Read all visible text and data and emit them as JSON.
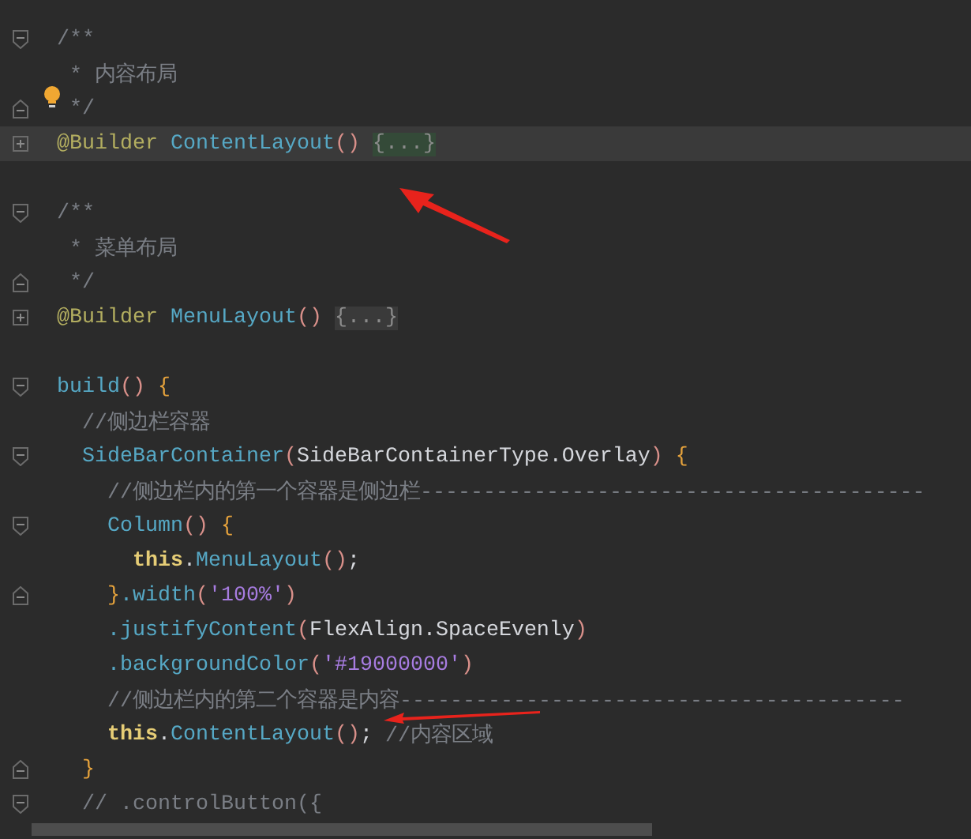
{
  "editor": {
    "lines": [
      {
        "kind": "fold-open",
        "current": false,
        "hint": false,
        "tokens": [
          {
            "kind": "comment",
            "text": "/**"
          }
        ]
      },
      {
        "kind": "plain",
        "current": false,
        "hint": false,
        "tokens": [
          {
            "kind": "comment",
            "text": " * 内容布局"
          }
        ]
      },
      {
        "kind": "fold-end",
        "current": false,
        "hint": true,
        "tokens": [
          {
            "kind": "comment",
            "text": " */"
          }
        ]
      },
      {
        "kind": "collapsed",
        "current": true,
        "hint": false,
        "tokens": [
          {
            "kind": "annotation",
            "text": "@Builder "
          },
          {
            "kind": "function",
            "text": "ContentLayout"
          },
          {
            "kind": "paren",
            "text": "() "
          },
          {
            "kind": "folded",
            "text": "{...}",
            "highlighted": true
          }
        ]
      },
      {
        "kind": "plain",
        "current": false,
        "hint": false
      },
      {
        "kind": "fold-open",
        "current": false,
        "hint": false,
        "tokens": [
          {
            "kind": "comment",
            "text": "/**"
          }
        ]
      },
      {
        "kind": "plain",
        "current": false,
        "hint": false,
        "tokens": [
          {
            "kind": "comment",
            "text": " * 菜单布局"
          }
        ]
      },
      {
        "kind": "fold-end",
        "current": false,
        "hint": false,
        "tokens": [
          {
            "kind": "comment",
            "text": " */"
          }
        ]
      },
      {
        "kind": "collapsed",
        "current": false,
        "hint": false,
        "tokens": [
          {
            "kind": "annotation",
            "text": "@Builder "
          },
          {
            "kind": "function",
            "text": "MenuLayout"
          },
          {
            "kind": "paren",
            "text": "() "
          },
          {
            "kind": "folded",
            "text": "{...}",
            "highlighted": false
          }
        ]
      },
      {
        "kind": "plain",
        "current": false,
        "hint": false
      },
      {
        "kind": "fold-open",
        "current": false,
        "hint": false,
        "tokens": [
          {
            "kind": "function",
            "text": "build"
          },
          {
            "kind": "paren",
            "text": "() "
          },
          {
            "kind": "brace",
            "text": "{"
          }
        ]
      },
      {
        "kind": "plain",
        "current": false,
        "hint": false,
        "tokens": [
          {
            "kind": "comment",
            "text": "  //侧边栏容器"
          }
        ]
      },
      {
        "kind": "fold-open",
        "current": false,
        "hint": false,
        "tokens": [
          {
            "kind": "function",
            "text": "  SideBarContainer"
          },
          {
            "kind": "paren",
            "text": "("
          },
          {
            "kind": "plain",
            "text": "SideBarContainerType.Overlay"
          },
          {
            "kind": "paren",
            "text": ") "
          },
          {
            "kind": "brace",
            "text": "{"
          }
        ]
      },
      {
        "kind": "plain",
        "current": false,
        "hint": false,
        "tokens": [
          {
            "kind": "comment",
            "text": "    //侧边栏内的第一个容器是侧边栏----------------------------------------"
          }
        ]
      },
      {
        "kind": "fold-open",
        "current": false,
        "hint": false,
        "tokens": [
          {
            "kind": "function",
            "text": "    Column"
          },
          {
            "kind": "paren",
            "text": "() "
          },
          {
            "kind": "brace",
            "text": "{"
          }
        ]
      },
      {
        "kind": "plain",
        "current": false,
        "hint": false,
        "tokens": [
          {
            "kind": "keyword",
            "text": "      this"
          },
          {
            "kind": "plain",
            "text": "."
          },
          {
            "kind": "function",
            "text": "MenuLayout"
          },
          {
            "kind": "paren",
            "text": "()"
          },
          {
            "kind": "plain",
            "text": ";"
          }
        ]
      },
      {
        "kind": "fold-end",
        "current": false,
        "hint": false,
        "tokens": [
          {
            "kind": "brace",
            "text": "    }"
          },
          {
            "kind": "function",
            "text": ".width"
          },
          {
            "kind": "paren",
            "text": "("
          },
          {
            "kind": "string",
            "text": "'100%'"
          },
          {
            "kind": "paren",
            "text": ")"
          }
        ]
      },
      {
        "kind": "plain",
        "current": false,
        "hint": false,
        "tokens": [
          {
            "kind": "function",
            "text": "    .justifyContent"
          },
          {
            "kind": "paren",
            "text": "("
          },
          {
            "kind": "plain",
            "text": "FlexAlign.SpaceEvenly"
          },
          {
            "kind": "paren",
            "text": ")"
          }
        ]
      },
      {
        "kind": "plain",
        "current": false,
        "hint": false,
        "tokens": [
          {
            "kind": "function",
            "text": "    .backgroundColor"
          },
          {
            "kind": "paren",
            "text": "("
          },
          {
            "kind": "string",
            "text": "'#19000000'"
          },
          {
            "kind": "paren",
            "text": ")"
          }
        ]
      },
      {
        "kind": "plain",
        "current": false,
        "hint": false,
        "tokens": [
          {
            "kind": "comment",
            "text": "    //侧边栏内的第二个容器是内容----------------------------------------"
          }
        ]
      },
      {
        "kind": "plain",
        "current": false,
        "hint": false,
        "tokens": [
          {
            "kind": "keyword",
            "text": "    this"
          },
          {
            "kind": "plain",
            "text": "."
          },
          {
            "kind": "function",
            "text": "ContentLayout"
          },
          {
            "kind": "paren",
            "text": "()"
          },
          {
            "kind": "plain",
            "text": "; "
          },
          {
            "kind": "comment",
            "text": "//内容区域"
          }
        ]
      },
      {
        "kind": "fold-end",
        "current": false,
        "hint": false,
        "tokens": [
          {
            "kind": "brace",
            "text": "  }"
          }
        ]
      },
      {
        "kind": "fold-open",
        "current": false,
        "hint": false,
        "tokens": [
          {
            "kind": "comment",
            "text": "  // .controlButton({"
          }
        ]
      }
    ]
  }
}
